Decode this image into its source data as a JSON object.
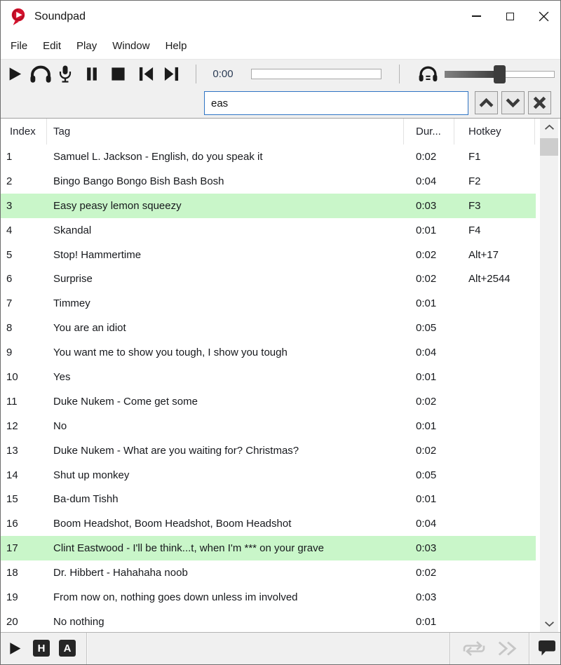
{
  "window": {
    "title": "Soundpad"
  },
  "menu": {
    "items": [
      "File",
      "Edit",
      "Play",
      "Window",
      "Help"
    ]
  },
  "toolbar": {
    "time": "0:00",
    "icons": [
      "play-icon",
      "headphones-icon",
      "microphone-icon",
      "pause-icon",
      "stop-icon",
      "skip-previous-icon",
      "skip-next-icon",
      "listen-volume-icon"
    ]
  },
  "search": {
    "value": "eas",
    "buttons": [
      "find-previous",
      "find-next",
      "close-search"
    ]
  },
  "table": {
    "columns": [
      "Index",
      "Tag",
      "Dur...",
      "Hotkey"
    ],
    "rows": [
      {
        "index": "1",
        "tag": "Samuel L. Jackson - English, do you speak it",
        "dur": "0:02",
        "hotkey": "F1",
        "highlight": false
      },
      {
        "index": "2",
        "tag": "Bingo Bango Bongo Bish Bash Bosh",
        "dur": "0:04",
        "hotkey": "F2",
        "highlight": false
      },
      {
        "index": "3",
        "tag": "Easy peasy lemon squeezy",
        "dur": "0:03",
        "hotkey": "F3",
        "highlight": true
      },
      {
        "index": "4",
        "tag": "Skandal",
        "dur": "0:01",
        "hotkey": "F4",
        "highlight": false
      },
      {
        "index": "5",
        "tag": "Stop! Hammertime",
        "dur": "0:02",
        "hotkey": "Alt+17",
        "highlight": false
      },
      {
        "index": "6",
        "tag": "Surprise",
        "dur": "0:02",
        "hotkey": "Alt+2544",
        "highlight": false
      },
      {
        "index": "7",
        "tag": "Timmey",
        "dur": "0:01",
        "hotkey": "",
        "highlight": false
      },
      {
        "index": "8",
        "tag": "You are an idiot",
        "dur": "0:05",
        "hotkey": "",
        "highlight": false
      },
      {
        "index": "9",
        "tag": "You want me to show you tough, I show you tough",
        "dur": "0:04",
        "hotkey": "",
        "highlight": false
      },
      {
        "index": "10",
        "tag": "Yes",
        "dur": "0:01",
        "hotkey": "",
        "highlight": false
      },
      {
        "index": "11",
        "tag": "Duke Nukem - Come get some",
        "dur": "0:02",
        "hotkey": "",
        "highlight": false
      },
      {
        "index": "12",
        "tag": "No",
        "dur": "0:01",
        "hotkey": "",
        "highlight": false
      },
      {
        "index": "13",
        "tag": "Duke Nukem - What are you waiting for? Christmas?",
        "dur": "0:02",
        "hotkey": "",
        "highlight": false
      },
      {
        "index": "14",
        "tag": "Shut up monkey",
        "dur": "0:05",
        "hotkey": "",
        "highlight": false
      },
      {
        "index": "15",
        "tag": "Ba-dum Tishh",
        "dur": "0:01",
        "hotkey": "",
        "highlight": false
      },
      {
        "index": "16",
        "tag": "Boom Headshot, Boom Headshot, Boom Headshot",
        "dur": "0:04",
        "hotkey": "",
        "highlight": false
      },
      {
        "index": "17",
        "tag": "Clint Eastwood - I'll be think...t, when I'm *** on your grave",
        "dur": "0:03",
        "hotkey": "",
        "highlight": true
      },
      {
        "index": "18",
        "tag": "Dr. Hibbert - Hahahaha noob",
        "dur": "0:02",
        "hotkey": "",
        "highlight": false
      },
      {
        "index": "19",
        "tag": "From now on, nothing goes down unless im involved",
        "dur": "0:03",
        "hotkey": "",
        "highlight": false
      },
      {
        "index": "20",
        "tag": "No nothing",
        "dur": "0:01",
        "hotkey": "",
        "highlight": false
      }
    ]
  },
  "statusbar": {
    "hotkeys_label": "H",
    "autoplay_label": "A",
    "icons": [
      "play-status-icon",
      "repeat-icon",
      "fast-forward-icon",
      "feedback-bubble-icon"
    ]
  },
  "colors": {
    "accent_blue": "#2e74c4",
    "row_highlight": "#c9f6c9",
    "logo_red": "#d3112c",
    "disabled_icon": "#c6c6c6",
    "time_text": "#2b3c55"
  }
}
